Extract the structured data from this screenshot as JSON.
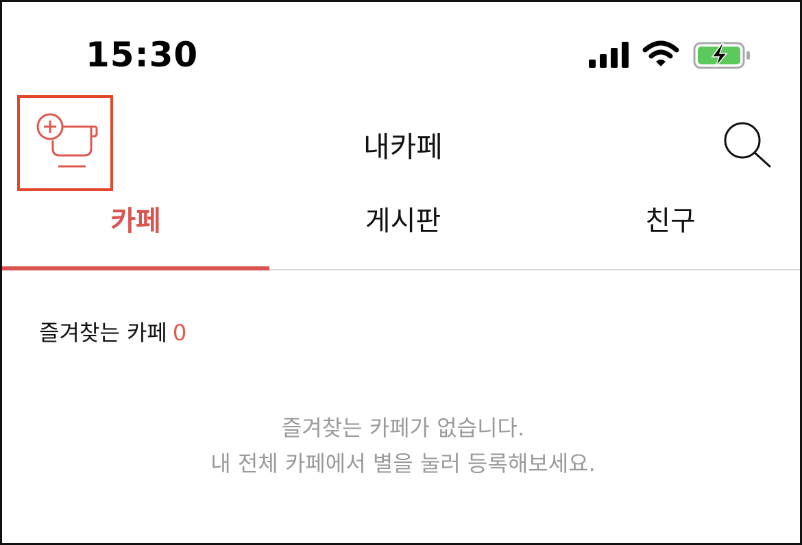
{
  "status_bar": {
    "time": "15:30",
    "icons": [
      "signal-icon",
      "wifi-icon",
      "battery-charging-icon"
    ],
    "battery_color": "#5cc95c"
  },
  "nav": {
    "title": "내카페",
    "left_icon": "cafe-add-icon",
    "right_icon": "search-icon",
    "highlight_color": "#e3472a"
  },
  "tabs": [
    {
      "label": "카페",
      "active": true
    },
    {
      "label": "게시판",
      "active": false
    },
    {
      "label": "친구",
      "active": false
    }
  ],
  "accent_color": "#d9534f",
  "favorites": {
    "label": "즐겨찾는 카페",
    "count": "0",
    "empty_line1": "즐겨찾는 카페가 없습니다.",
    "empty_line2": "내 전체 카페에서 별을 눌러 등록해보세요."
  }
}
